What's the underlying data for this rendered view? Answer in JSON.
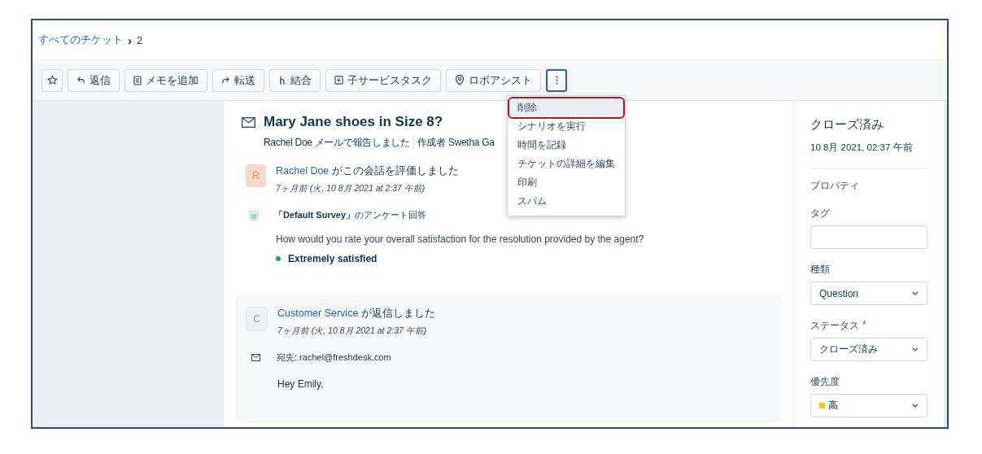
{
  "breadcrumb": {
    "link": "すべてのチケット",
    "separator": "›",
    "current": "2"
  },
  "toolbar": [
    {
      "kind": "star"
    },
    {
      "kind": "reply",
      "label": "返信"
    },
    {
      "kind": "note",
      "label": "メモを追加"
    },
    {
      "kind": "forward",
      "label": "転送"
    },
    {
      "kind": "merge",
      "label": "結合"
    },
    {
      "kind": "child",
      "label": "子サービスタスク"
    },
    {
      "kind": "robo",
      "label": "ロボアシスト"
    },
    {
      "kind": "more",
      "open": true
    }
  ],
  "menu": [
    {
      "label": "削除",
      "selected": true
    },
    {
      "label": "シナリオを実行",
      "selected": false
    },
    {
      "label": "時間を記録",
      "selected": false
    },
    {
      "label": "チケットの詳細を編集",
      "selected": false
    },
    {
      "label": "印刷",
      "selected": false
    },
    {
      "label": "スパム",
      "selected": false
    }
  ],
  "ticket": {
    "title": "Mary Jane shoes in Size 8?",
    "reporter": "Rachel Doe",
    "reported": "メールで報告しました",
    "author_label": "作成者",
    "author": "Swetha Ga"
  },
  "conversations": [
    {
      "kind": "survey",
      "avatar": "R",
      "name": "Rachel Doe",
      "action": "がこの会話を評価しました",
      "time": "7ヶ月前 (火, 10 8月 2021 at 2:37 午前)",
      "survey": "**「Default Survey」**のアンケート回答",
      "question": "How would you rate your overall satisfaction for the resolution provided by the agent?",
      "answer": "Extremely satisfied",
      "color": "#1aa37e"
    },
    {
      "kind": "reply",
      "avatar": "C",
      "name": "Customer Service",
      "action": "が返信しました",
      "time": "7ヶ月前 (火, 10 8月 2021 at 2:37 午前)",
      "to": "宛先: rachel@freshdesk.com",
      "body": "Hey Emily,"
    }
  ],
  "side": {
    "status": "クローズ済み",
    "date": "10 8月 2021, 02:37 午前",
    "section": "プロパティ",
    "fields": [
      {
        "kind": "text",
        "label": "タグ"
      },
      {
        "kind": "select",
        "label": "種類",
        "value": "Question"
      },
      {
        "kind": "select",
        "label": "ステータス",
        "value": "クローズ済み",
        "required_mark": "*"
      },
      {
        "kind": "select",
        "label": "優先度",
        "value": "高",
        "color": "#ffc50d"
      }
    ]
  }
}
